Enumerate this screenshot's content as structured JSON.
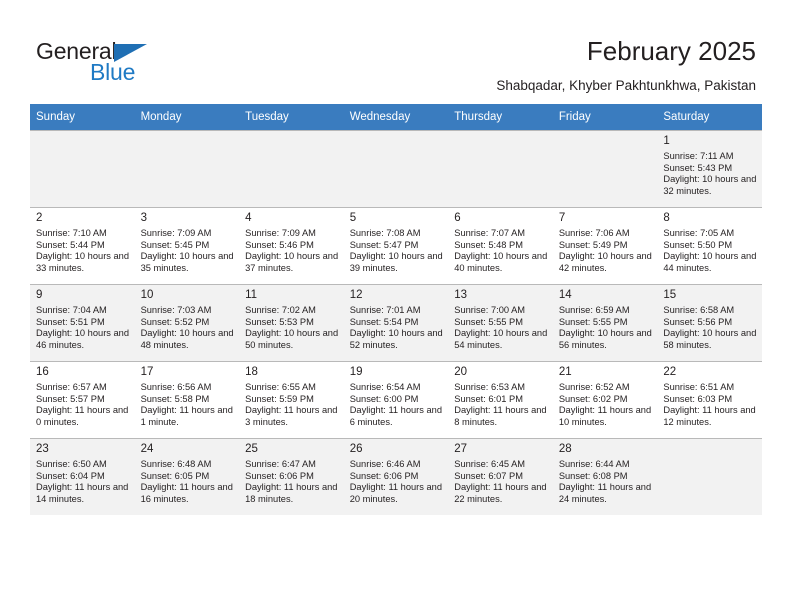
{
  "brand": {
    "name_part1": "General",
    "name_part2": "Blue",
    "triangle_icon": "triangle-icon",
    "accent_color": "#1f7ac4"
  },
  "header": {
    "title": "February 2025",
    "subtitle": "Shabqadar, Khyber Pakhtunkhwa, Pakistan"
  },
  "calendar": {
    "header_bg": "#3a7cbf",
    "weekdays": [
      "Sunday",
      "Monday",
      "Tuesday",
      "Wednesday",
      "Thursday",
      "Friday",
      "Saturday"
    ],
    "weeks": [
      [
        {
          "day": "",
          "sunrise": "",
          "sunset": "",
          "daylight": ""
        },
        {
          "day": "",
          "sunrise": "",
          "sunset": "",
          "daylight": ""
        },
        {
          "day": "",
          "sunrise": "",
          "sunset": "",
          "daylight": ""
        },
        {
          "day": "",
          "sunrise": "",
          "sunset": "",
          "daylight": ""
        },
        {
          "day": "",
          "sunrise": "",
          "sunset": "",
          "daylight": ""
        },
        {
          "day": "",
          "sunrise": "",
          "sunset": "",
          "daylight": ""
        },
        {
          "day": "1",
          "sunrise": "Sunrise: 7:11 AM",
          "sunset": "Sunset: 5:43 PM",
          "daylight": "Daylight: 10 hours and 32 minutes."
        }
      ],
      [
        {
          "day": "2",
          "sunrise": "Sunrise: 7:10 AM",
          "sunset": "Sunset: 5:44 PM",
          "daylight": "Daylight: 10 hours and 33 minutes."
        },
        {
          "day": "3",
          "sunrise": "Sunrise: 7:09 AM",
          "sunset": "Sunset: 5:45 PM",
          "daylight": "Daylight: 10 hours and 35 minutes."
        },
        {
          "day": "4",
          "sunrise": "Sunrise: 7:09 AM",
          "sunset": "Sunset: 5:46 PM",
          "daylight": "Daylight: 10 hours and 37 minutes."
        },
        {
          "day": "5",
          "sunrise": "Sunrise: 7:08 AM",
          "sunset": "Sunset: 5:47 PM",
          "daylight": "Daylight: 10 hours and 39 minutes."
        },
        {
          "day": "6",
          "sunrise": "Sunrise: 7:07 AM",
          "sunset": "Sunset: 5:48 PM",
          "daylight": "Daylight: 10 hours and 40 minutes."
        },
        {
          "day": "7",
          "sunrise": "Sunrise: 7:06 AM",
          "sunset": "Sunset: 5:49 PM",
          "daylight": "Daylight: 10 hours and 42 minutes."
        },
        {
          "day": "8",
          "sunrise": "Sunrise: 7:05 AM",
          "sunset": "Sunset: 5:50 PM",
          "daylight": "Daylight: 10 hours and 44 minutes."
        }
      ],
      [
        {
          "day": "9",
          "sunrise": "Sunrise: 7:04 AM",
          "sunset": "Sunset: 5:51 PM",
          "daylight": "Daylight: 10 hours and 46 minutes."
        },
        {
          "day": "10",
          "sunrise": "Sunrise: 7:03 AM",
          "sunset": "Sunset: 5:52 PM",
          "daylight": "Daylight: 10 hours and 48 minutes."
        },
        {
          "day": "11",
          "sunrise": "Sunrise: 7:02 AM",
          "sunset": "Sunset: 5:53 PM",
          "daylight": "Daylight: 10 hours and 50 minutes."
        },
        {
          "day": "12",
          "sunrise": "Sunrise: 7:01 AM",
          "sunset": "Sunset: 5:54 PM",
          "daylight": "Daylight: 10 hours and 52 minutes."
        },
        {
          "day": "13",
          "sunrise": "Sunrise: 7:00 AM",
          "sunset": "Sunset: 5:55 PM",
          "daylight": "Daylight: 10 hours and 54 minutes."
        },
        {
          "day": "14",
          "sunrise": "Sunrise: 6:59 AM",
          "sunset": "Sunset: 5:55 PM",
          "daylight": "Daylight: 10 hours and 56 minutes."
        },
        {
          "day": "15",
          "sunrise": "Sunrise: 6:58 AM",
          "sunset": "Sunset: 5:56 PM",
          "daylight": "Daylight: 10 hours and 58 minutes."
        }
      ],
      [
        {
          "day": "16",
          "sunrise": "Sunrise: 6:57 AM",
          "sunset": "Sunset: 5:57 PM",
          "daylight": "Daylight: 11 hours and 0 minutes."
        },
        {
          "day": "17",
          "sunrise": "Sunrise: 6:56 AM",
          "sunset": "Sunset: 5:58 PM",
          "daylight": "Daylight: 11 hours and 1 minute."
        },
        {
          "day": "18",
          "sunrise": "Sunrise: 6:55 AM",
          "sunset": "Sunset: 5:59 PM",
          "daylight": "Daylight: 11 hours and 3 minutes."
        },
        {
          "day": "19",
          "sunrise": "Sunrise: 6:54 AM",
          "sunset": "Sunset: 6:00 PM",
          "daylight": "Daylight: 11 hours and 6 minutes."
        },
        {
          "day": "20",
          "sunrise": "Sunrise: 6:53 AM",
          "sunset": "Sunset: 6:01 PM",
          "daylight": "Daylight: 11 hours and 8 minutes."
        },
        {
          "day": "21",
          "sunrise": "Sunrise: 6:52 AM",
          "sunset": "Sunset: 6:02 PM",
          "daylight": "Daylight: 11 hours and 10 minutes."
        },
        {
          "day": "22",
          "sunrise": "Sunrise: 6:51 AM",
          "sunset": "Sunset: 6:03 PM",
          "daylight": "Daylight: 11 hours and 12 minutes."
        }
      ],
      [
        {
          "day": "23",
          "sunrise": "Sunrise: 6:50 AM",
          "sunset": "Sunset: 6:04 PM",
          "daylight": "Daylight: 11 hours and 14 minutes."
        },
        {
          "day": "24",
          "sunrise": "Sunrise: 6:48 AM",
          "sunset": "Sunset: 6:05 PM",
          "daylight": "Daylight: 11 hours and 16 minutes."
        },
        {
          "day": "25",
          "sunrise": "Sunrise: 6:47 AM",
          "sunset": "Sunset: 6:06 PM",
          "daylight": "Daylight: 11 hours and 18 minutes."
        },
        {
          "day": "26",
          "sunrise": "Sunrise: 6:46 AM",
          "sunset": "Sunset: 6:06 PM",
          "daylight": "Daylight: 11 hours and 20 minutes."
        },
        {
          "day": "27",
          "sunrise": "Sunrise: 6:45 AM",
          "sunset": "Sunset: 6:07 PM",
          "daylight": "Daylight: 11 hours and 22 minutes."
        },
        {
          "day": "28",
          "sunrise": "Sunrise: 6:44 AM",
          "sunset": "Sunset: 6:08 PM",
          "daylight": "Daylight: 11 hours and 24 minutes."
        },
        {
          "day": "",
          "sunrise": "",
          "sunset": "",
          "daylight": ""
        }
      ]
    ]
  }
}
